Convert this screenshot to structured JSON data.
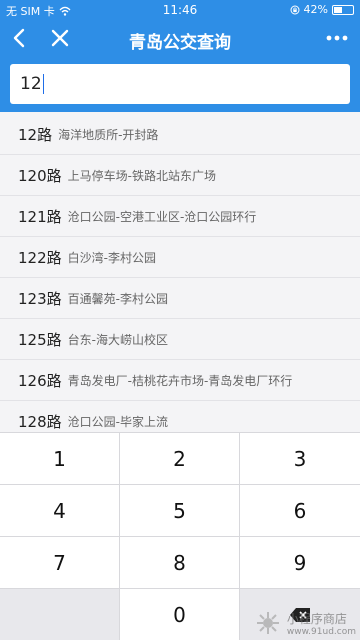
{
  "status_bar": {
    "carrier": "无 SIM 卡",
    "time": "11:46",
    "battery": "42%",
    "battery_level": 0.42
  },
  "nav": {
    "title": "青岛公交查询",
    "back_icon": "chevron-left-icon",
    "close_icon": "close-icon",
    "more_icon": "more-dots-icon"
  },
  "search": {
    "value": "12",
    "placeholder": ""
  },
  "results": [
    {
      "route": "12路",
      "desc": "海洋地质所-开封路"
    },
    {
      "route": "120路",
      "desc": "上马停车场-铁路北站东广场"
    },
    {
      "route": "121路",
      "desc": "沧口公园-空港工业区-沧口公园环行"
    },
    {
      "route": "122路",
      "desc": "白沙湾-李村公园"
    },
    {
      "route": "123路",
      "desc": "百通馨苑-李村公园"
    },
    {
      "route": "125路",
      "desc": "台东-海大崂山校区"
    },
    {
      "route": "126路",
      "desc": "青岛发电厂-桔桃花卉市场-青岛发电厂环行"
    },
    {
      "route": "128路",
      "desc": "沧口公园-毕家上流"
    }
  ],
  "keypad": {
    "keys": [
      "1",
      "2",
      "3",
      "4",
      "5",
      "6",
      "7",
      "8",
      "9",
      "",
      "0",
      "delete"
    ]
  },
  "watermark": {
    "name": "小程序商店",
    "url": "www.91ud.com"
  },
  "colors": {
    "brand": "#2e8ee6",
    "list_bg": "#f4f4f6",
    "key_gray": "#e8e8ec"
  }
}
